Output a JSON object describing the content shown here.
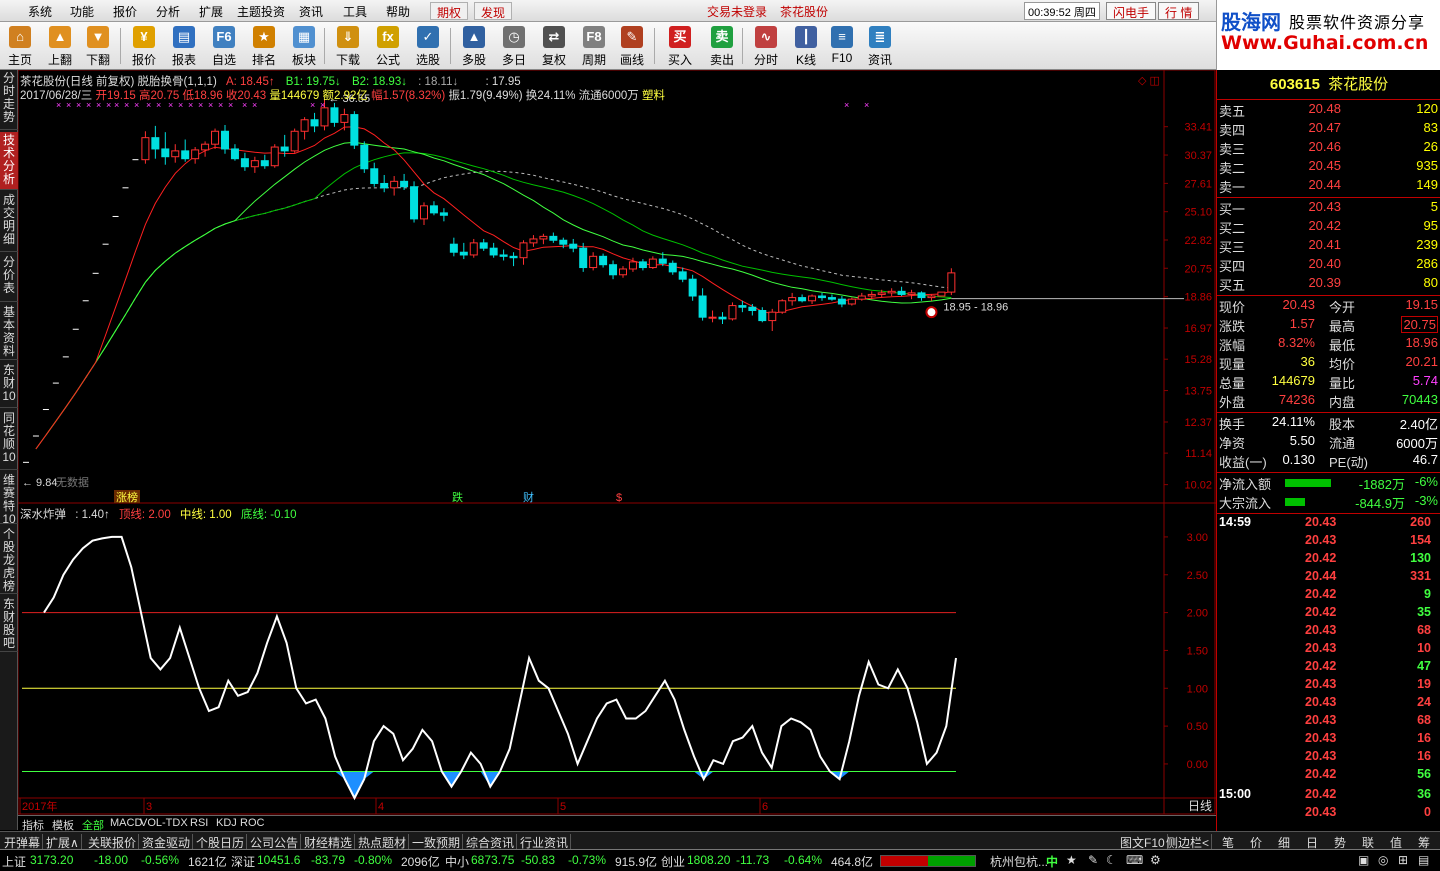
{
  "menu": {
    "items": [
      "系统",
      "功能",
      "报价",
      "分析",
      "扩展",
      "主题投资",
      "资讯",
      "工具",
      "帮助"
    ],
    "tabs": [
      "期权",
      "发现"
    ],
    "login": "交易未登录",
    "stock": "茶花股份",
    "clock": "00:39:52 周四",
    "buttons": [
      "闪电手",
      "行 情"
    ]
  },
  "brand": {
    "name": "股海网",
    "slogan": "股票软件资源分享",
    "url": "Www.Guhai.com.cn"
  },
  "toolbar": {
    "items": [
      {
        "label": "主页",
        "icon": "home-icon",
        "color": "#d08020",
        "glyph": "⌂"
      },
      {
        "label": "上翻",
        "icon": "arrow-up-icon",
        "color": "#e09020",
        "glyph": "▲"
      },
      {
        "label": "下翻",
        "icon": "arrow-down-icon",
        "color": "#e09020",
        "glyph": "▼"
      },
      {
        "label": "报价",
        "icon": "yen-icon",
        "color": "#e0a000",
        "glyph": "¥"
      },
      {
        "label": "报表",
        "icon": "report-icon",
        "color": "#3070c0",
        "glyph": "▤"
      },
      {
        "label": "自选",
        "icon": "f6-icon",
        "color": "#4080c0",
        "glyph": "F6"
      },
      {
        "label": "排名",
        "icon": "rank-icon",
        "color": "#d08000",
        "glyph": "★"
      },
      {
        "label": "板块",
        "icon": "sector-icon",
        "color": "#5090d0",
        "glyph": "▦"
      },
      {
        "label": "下载",
        "icon": "download-icon",
        "color": "#d09010",
        "glyph": "⇓"
      },
      {
        "label": "公式",
        "icon": "formula-icon",
        "color": "#d0a000",
        "glyph": "fx"
      },
      {
        "label": "选股",
        "icon": "select-icon",
        "color": "#3070b0",
        "glyph": "✓"
      },
      {
        "label": "多股",
        "icon": "multi-stock-icon",
        "color": "#3060a0",
        "glyph": "▲"
      },
      {
        "label": "多日",
        "icon": "multi-day-icon",
        "color": "#707070",
        "glyph": "◷"
      },
      {
        "label": "复权",
        "icon": "restore-icon",
        "color": "#505050",
        "glyph": "⇄"
      },
      {
        "label": "周期",
        "icon": "period-icon",
        "color": "#808080",
        "glyph": "F8"
      },
      {
        "label": "画线",
        "icon": "draw-icon",
        "color": "#b04020",
        "glyph": "✎"
      },
      {
        "label": "买入",
        "icon": "buy-icon",
        "color": "#d02020",
        "glyph": "买"
      },
      {
        "label": "卖出",
        "icon": "sell-icon",
        "color": "#20a040",
        "glyph": "卖"
      },
      {
        "label": "分时",
        "icon": "timeshare-icon",
        "color": "#c04040",
        "glyph": "∿"
      },
      {
        "label": "K线",
        "icon": "kline-icon",
        "color": "#4060a0",
        "glyph": "┃"
      },
      {
        "label": "F10",
        "icon": "f10-icon",
        "color": "#3070b0",
        "glyph": "≡"
      },
      {
        "label": "资讯",
        "icon": "news-icon",
        "color": "#3080c0",
        "glyph": "≣"
      }
    ]
  },
  "lefttabs": [
    "分时走势",
    "技术分析",
    "成交明细",
    "分价表",
    "基本资料",
    "东财10",
    "同花顺10",
    "维赛特10",
    "个股龙虎榜",
    "东财股吧"
  ],
  "chart": {
    "title": "茶花股份(日线 前复权) 脱胎换骨(1,1,1)",
    "ind_a": "A: 18.45↑",
    "ind_b1": "B1: 19.75↓",
    "ind_b2": "B2: 18.93↓",
    "ind_c": ": 18.11↓",
    "ind_d": ": 17.95",
    "date": "2017/06/28/三",
    "open": "开19.15",
    "high": "高20.75",
    "low": "低18.96",
    "close": "收20.43",
    "vol": "量144679",
    "amount": "额2.92亿",
    "range": "幅1.57(8.32%)",
    "swing": "振1.79(9.49%)",
    "turn": "换24.11%",
    "float": "流通6000万",
    "sector": "塑料",
    "high_label": "36.55",
    "low_label": "9.84",
    "nodata": "无数据",
    "range_label": "18.95 - 18.96",
    "events": [
      "涨榜",
      "跌",
      "财",
      "$"
    ],
    "price_ticks": [
      "33.41",
      "30.37",
      "27.61",
      "25.10",
      "22.82",
      "20.75",
      "18.86",
      "16.97",
      "15.28",
      "13.75",
      "12.37",
      "11.14",
      "10.02"
    ],
    "sub_title": "深水炸弹",
    "sub_val": ": 1.40↑",
    "sub_top": "顶线: 2.00",
    "sub_mid": "中线: 1.00",
    "sub_bottom": "底线: -0.10",
    "sub_ticks": [
      "3.00",
      "2.50",
      "2.00",
      "1.50",
      "1.00",
      "0.50",
      "0.00"
    ],
    "x_labels": [
      "2017年",
      "3",
      "4",
      "5",
      "6"
    ],
    "period": "日线"
  },
  "chart_data": {
    "type": "candlestick",
    "title": "茶花股份(日线 前复权)",
    "candles": [
      [
        9.84,
        10.9,
        9.84,
        10.8
      ],
      [
        10.8,
        11.9,
        10.6,
        11.8
      ],
      [
        11.8,
        13.0,
        11.7,
        12.9
      ],
      [
        12.9,
        14.2,
        12.8,
        14.1
      ],
      [
        14.1,
        15.5,
        14.0,
        15.4
      ],
      [
        15.4,
        16.9,
        15.3,
        16.9
      ],
      [
        16.9,
        18.6,
        16.9,
        18.6
      ],
      [
        18.6,
        20.4,
        18.6,
        20.4
      ],
      [
        20.4,
        22.5,
        20.4,
        22.5
      ],
      [
        22.5,
        24.7,
        22.5,
        24.7
      ],
      [
        24.7,
        27.2,
        24.7,
        27.2
      ],
      [
        27.2,
        29.9,
        27.2,
        29.9
      ],
      [
        29.9,
        32.9,
        29.5,
        32.2
      ],
      [
        32.2,
        33.5,
        30.0,
        31.0
      ],
      [
        31.0,
        32.8,
        29.4,
        30.2
      ],
      [
        30.2,
        31.5,
        29.6,
        30.8
      ],
      [
        30.8,
        32.0,
        29.7,
        30.0
      ],
      [
        30.0,
        31.2,
        29.5,
        30.9
      ],
      [
        30.9,
        31.8,
        30.2,
        31.5
      ],
      [
        31.5,
        33.2,
        31.0,
        32.9
      ],
      [
        32.9,
        33.6,
        30.5,
        31.0
      ],
      [
        31.0,
        31.5,
        29.8,
        30.0
      ],
      [
        30.0,
        30.6,
        28.8,
        29.2
      ],
      [
        29.2,
        30.2,
        28.6,
        29.8
      ],
      [
        29.8,
        30.4,
        29.0,
        29.3
      ],
      [
        29.3,
        31.5,
        29.1,
        31.2
      ],
      [
        31.2,
        32.5,
        30.2,
        30.8
      ],
      [
        30.8,
        33.2,
        30.6,
        32.9
      ],
      [
        32.9,
        34.5,
        32.0,
        34.2
      ],
      [
        34.2,
        35.0,
        32.8,
        33.5
      ],
      [
        33.5,
        36.55,
        33.0,
        35.6
      ],
      [
        35.6,
        36.2,
        33.4,
        33.9
      ],
      [
        33.9,
        35.5,
        33.0,
        34.8
      ],
      [
        34.8,
        35.2,
        31.0,
        31.4
      ],
      [
        31.4,
        31.8,
        28.6,
        29.0
      ],
      [
        29.0,
        29.6,
        27.3,
        27.6
      ],
      [
        27.6,
        28.4,
        26.8,
        27.2
      ],
      [
        27.2,
        28.3,
        26.5,
        27.8
      ],
      [
        27.8,
        28.5,
        27.0,
        27.3
      ],
      [
        27.3,
        27.8,
        24.2,
        24.5
      ],
      [
        24.5,
        25.9,
        24.0,
        25.6
      ],
      [
        25.6,
        26.0,
        24.8,
        25.0
      ],
      [
        25.0,
        25.4,
        24.3,
        24.8
      ],
      [
        22.5,
        23.0,
        21.6,
        21.9
      ],
      [
        21.9,
        22.6,
        21.4,
        21.7
      ],
      [
        21.7,
        22.9,
        21.5,
        22.6
      ],
      [
        22.6,
        22.9,
        22.0,
        22.2
      ],
      [
        22.2,
        22.6,
        21.5,
        21.7
      ],
      [
        21.7,
        22.1,
        21.3,
        21.6
      ],
      [
        21.6,
        21.9,
        20.9,
        21.5
      ],
      [
        21.5,
        22.8,
        21.0,
        22.6
      ],
      [
        22.6,
        23.2,
        22.3,
        22.9
      ],
      [
        22.9,
        23.3,
        22.5,
        23.1
      ],
      [
        23.1,
        23.4,
        22.6,
        22.8
      ],
      [
        22.8,
        23.0,
        22.2,
        22.5
      ],
      [
        22.5,
        22.9,
        21.9,
        22.2
      ],
      [
        22.2,
        22.6,
        20.5,
        20.8
      ],
      [
        20.8,
        21.9,
        20.6,
        21.6
      ],
      [
        21.6,
        21.8,
        20.8,
        21.0
      ],
      [
        21.0,
        21.3,
        20.0,
        20.3
      ],
      [
        20.3,
        20.9,
        20.1,
        20.7
      ],
      [
        20.7,
        21.5,
        20.5,
        21.2
      ],
      [
        21.2,
        21.4,
        20.6,
        20.8
      ],
      [
        20.8,
        21.6,
        20.7,
        21.4
      ],
      [
        21.4,
        21.9,
        20.9,
        21.1
      ],
      [
        21.1,
        21.3,
        20.3,
        20.5
      ],
      [
        20.5,
        20.8,
        19.8,
        20.0
      ],
      [
        20.0,
        20.3,
        18.6,
        18.9
      ],
      [
        18.9,
        19.4,
        17.4,
        17.6
      ],
      [
        17.6,
        18.0,
        17.3,
        17.6
      ],
      [
        17.6,
        17.9,
        17.2,
        17.5
      ],
      [
        17.5,
        18.5,
        17.4,
        18.3
      ],
      [
        18.3,
        18.6,
        17.9,
        18.2
      ],
      [
        18.2,
        18.4,
        17.7,
        18.0
      ],
      [
        18.0,
        18.2,
        17.3,
        17.4
      ],
      [
        17.4,
        18.1,
        16.8,
        17.9
      ],
      [
        17.9,
        18.7,
        17.8,
        18.6
      ],
      [
        18.6,
        19.1,
        18.3,
        18.8
      ],
      [
        18.8,
        19.0,
        18.5,
        18.6
      ],
      [
        18.6,
        19.0,
        18.4,
        18.9
      ],
      [
        18.9,
        19.1,
        18.6,
        18.8
      ],
      [
        18.8,
        19.0,
        18.6,
        18.7
      ],
      [
        18.7,
        18.9,
        18.2,
        18.4
      ],
      [
        18.4,
        18.8,
        18.3,
        18.7
      ],
      [
        18.7,
        19.1,
        18.6,
        18.9
      ],
      [
        18.9,
        19.2,
        18.7,
        19.0
      ],
      [
        19.0,
        19.3,
        18.8,
        19.1
      ],
      [
        19.1,
        19.4,
        18.9,
        19.2
      ],
      [
        19.2,
        19.5,
        18.9,
        19.0
      ],
      [
        19.0,
        19.3,
        18.7,
        19.1
      ],
      [
        19.1,
        19.2,
        18.6,
        18.8
      ],
      [
        18.8,
        19.0,
        18.6,
        18.9
      ],
      [
        18.9,
        19.1,
        18.96,
        19.15
      ],
      [
        19.15,
        20.75,
        18.96,
        20.43
      ]
    ],
    "indicator": [
      2.0,
      2.2,
      2.5,
      2.7,
      2.85,
      2.95,
      2.98,
      3.0,
      3.0,
      2.6,
      2.0,
      1.4,
      1.25,
      1.4,
      1.8,
      1.4,
      1.0,
      0.7,
      0.75,
      1.1,
      0.9,
      0.95,
      1.2,
      1.6,
      1.95,
      1.6,
      1.0,
      0.8,
      0.85,
      0.6,
      0.1,
      -0.2,
      -0.45,
      -0.2,
      0.3,
      0.5,
      0.4,
      0.05,
      0.2,
      0.45,
      0.3,
      -0.1,
      -0.3,
      -0.1,
      0.15,
      0.0,
      -0.3,
      -0.1,
      0.2,
      0.8,
      1.4,
      1.1,
      1.0,
      0.7,
      0.4,
      0.0,
      0.3,
      0.6,
      0.8,
      0.85,
      0.6,
      0.6,
      0.7,
      0.9,
      1.1,
      0.85,
      0.45,
      0.1,
      -0.2,
      0.05,
      0.0,
      0.3,
      0.35,
      0.5,
      0.15,
      -0.05,
      0.5,
      0.6,
      0.55,
      0.45,
      0.1,
      -0.1,
      -0.2,
      0.3,
      0.9,
      1.35,
      1.05,
      1.0,
      1.25,
      1.0,
      0.55,
      0.0,
      0.15,
      0.5,
      1.4
    ],
    "top_line": 2.0,
    "mid_line": 1.0,
    "bottom_line": -0.1,
    "ylim": [
      9.84,
      36.55
    ],
    "sub_ylim": [
      -0.45,
      3.0
    ]
  },
  "quote": {
    "code": "603615",
    "name": "茶花股份",
    "asks": [
      {
        "label": "卖五",
        "price": "20.48",
        "vol": "120"
      },
      {
        "label": "卖四",
        "price": "20.47",
        "vol": "83"
      },
      {
        "label": "卖三",
        "price": "20.46",
        "vol": "26"
      },
      {
        "label": "卖二",
        "price": "20.45",
        "vol": "935"
      },
      {
        "label": "卖一",
        "price": "20.44",
        "vol": "149"
      }
    ],
    "bids": [
      {
        "label": "买一",
        "price": "20.43",
        "vol": "5"
      },
      {
        "label": "买二",
        "price": "20.42",
        "vol": "95"
      },
      {
        "label": "买三",
        "price": "20.41",
        "vol": "239"
      },
      {
        "label": "买四",
        "price": "20.40",
        "vol": "286"
      },
      {
        "label": "买五",
        "price": "20.39",
        "vol": "80"
      }
    ],
    "stats": [
      [
        "现价",
        "20.43",
        "今开",
        "19.15"
      ],
      [
        "涨跌",
        "1.57",
        "最高",
        "20.75"
      ],
      [
        "涨幅",
        "8.32%",
        "最低",
        "18.96"
      ],
      [
        "现量",
        "36",
        "均价",
        "20.21"
      ],
      [
        "总量",
        "144679",
        "量比",
        "5.74"
      ],
      [
        "外盘",
        "74236",
        "内盘",
        "70443"
      ]
    ],
    "fund": [
      [
        "换手",
        "24.11%",
        "股本",
        "2.40亿"
      ],
      [
        "净资",
        "5.50",
        "流通",
        "6000万"
      ],
      [
        "收益(一)",
        "0.130",
        "PE(动)",
        "46.7"
      ]
    ],
    "flow": [
      {
        "label": "净流入额",
        "value": "-1882万",
        "pct": "-6%"
      },
      {
        "label": "大宗流入",
        "value": "-844.9万",
        "pct": "-3%"
      }
    ],
    "ticks": [
      [
        "14:59",
        "20.43",
        "260"
      ],
      [
        "",
        "20.43",
        "154"
      ],
      [
        "",
        "20.42",
        "130"
      ],
      [
        "",
        "20.44",
        "331"
      ],
      [
        "",
        "20.42",
        "9"
      ],
      [
        "",
        "20.42",
        "35"
      ],
      [
        "",
        "20.43",
        "68"
      ],
      [
        "",
        "20.43",
        "10"
      ],
      [
        "",
        "20.42",
        "47"
      ],
      [
        "",
        "20.43",
        "19"
      ],
      [
        "",
        "20.43",
        "24"
      ],
      [
        "",
        "20.43",
        "68"
      ],
      [
        "",
        "20.43",
        "16"
      ],
      [
        "",
        "20.43",
        "16"
      ],
      [
        "",
        "20.42",
        "56"
      ],
      [
        "15:00",
        "20.42",
        "36"
      ],
      [
        "",
        "20.43",
        "0"
      ]
    ],
    "rtabs": [
      "笔",
      "价",
      "细",
      "日",
      "势",
      "联",
      "值",
      "筹"
    ]
  },
  "idxtabs": [
    "指标",
    "模板",
    "全部",
    "MACD",
    "VOL-TDX",
    "RSI",
    "KDJ",
    "ROC"
  ],
  "bottomtabs": [
    "开弹幕",
    "扩展∧",
    "关联报价",
    "资金驱动",
    "个股日历",
    "公司公告",
    "财经精选",
    "热点题材",
    "一致预期",
    "综合资讯",
    "行业资讯"
  ],
  "bottom_right": [
    "图文F10",
    "侧边栏<"
  ],
  "status": {
    "sh": "上证",
    "sh_val": "3173.20",
    "sh_chg": "-18.00",
    "sh_pct": "-0.56%",
    "sh_amt": "1621亿",
    "sz": "深证",
    "sz_val": "10451.6",
    "sz_chg": "-83.79",
    "sz_pct": "-0.80%",
    "sz_amt": "2096亿",
    "zx": "中小",
    "zx_val": "6873.75",
    "zx_chg": "-50.83",
    "zx_pct": "-0.73%",
    "zx_amt": "915.9亿",
    "cy": "创业",
    "cy_val": "1808.20",
    "cy_chg": "-11.73",
    "cy_pct": "-0.64%",
    "cy_amt": "464.8亿",
    "city": "杭州包杭..."
  }
}
